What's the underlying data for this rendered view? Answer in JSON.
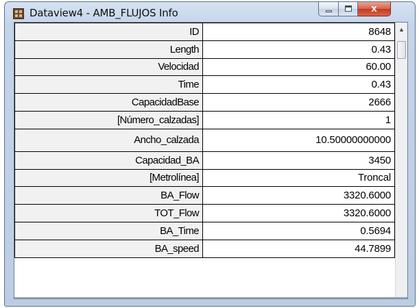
{
  "window": {
    "title": "Dataview4 - AMB_FLUJOS Info",
    "icon": "dataview-grid-icon",
    "controls": {
      "minimize": "minimize-icon",
      "maximize": "maximize-icon",
      "close_glyph": "x"
    }
  },
  "rows": [
    {
      "field": "ID",
      "value": "8648"
    },
    {
      "field": "Length",
      "value": "0.43"
    },
    {
      "field": "Velocidad",
      "value": "60.00"
    },
    {
      "field": "Time",
      "value": "0.43"
    },
    {
      "field": "CapacidadBase",
      "value": "2666"
    },
    {
      "field": "[Número_calzadas]",
      "value": "1"
    },
    {
      "field": "Ancho_calzada",
      "value": "10.50000000000"
    },
    {
      "field": "Capacidad_BA",
      "value": "3450"
    },
    {
      "field": "[Metrolínea]",
      "value": "Troncal"
    },
    {
      "field": "BA_Flow",
      "value": "3320.6000"
    },
    {
      "field": "TOT_Flow",
      "value": "3320.6000"
    },
    {
      "field": "BA_Time",
      "value": "0.5694"
    },
    {
      "field": "BA_speed",
      "value": "44.7899"
    }
  ],
  "scrollbar": {
    "up_arrow": "▲"
  }
}
